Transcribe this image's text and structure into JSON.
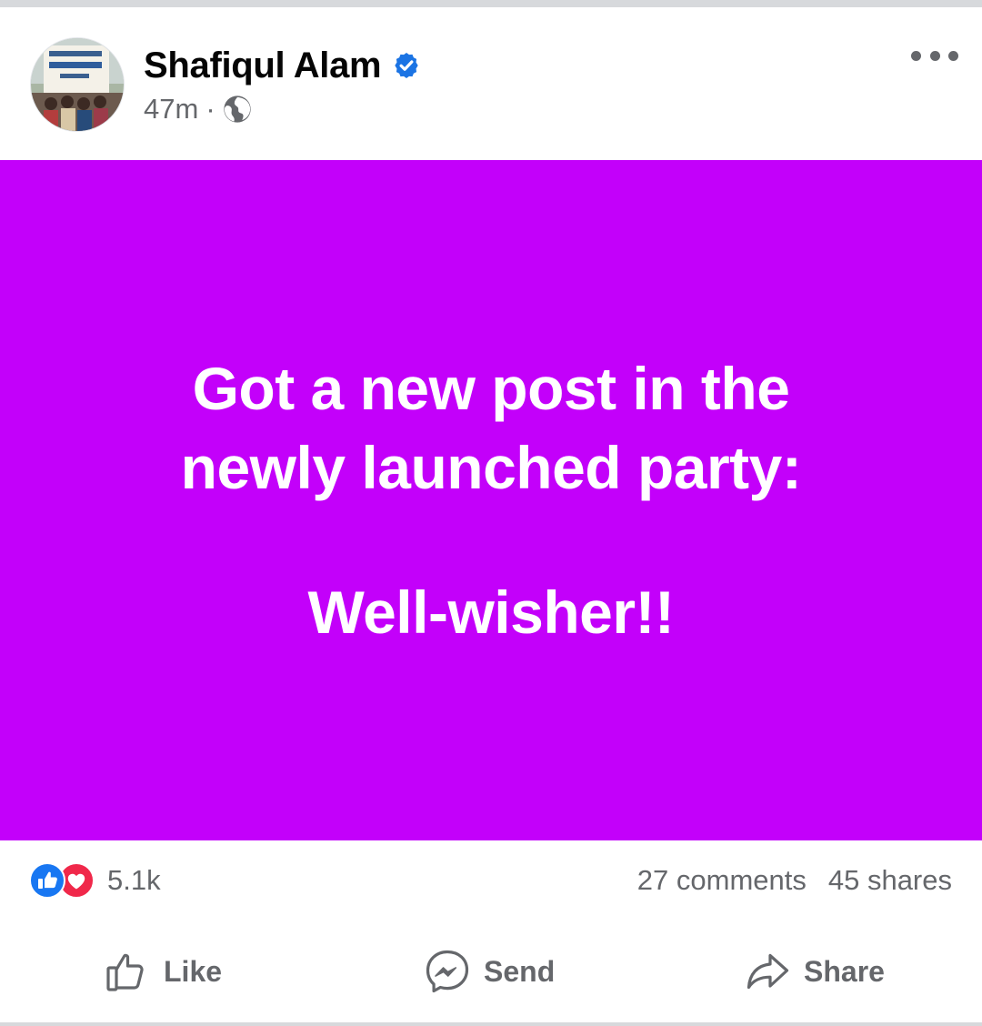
{
  "post": {
    "author": "Shafiqul Alam",
    "time": "47m",
    "separator": "·",
    "verified": true,
    "audience_icon": "globe-icon",
    "more_icon": "more-horizontal-icon",
    "background_color": "#c300fa",
    "text_color": "#ffffff",
    "text_lines": [
      "Got a new post in the",
      "newly launched party:"
    ],
    "closing_line": "Well-wisher!!"
  },
  "stats": {
    "reactions_count": "5.1k",
    "reaction_icons": [
      "like-reaction-icon",
      "love-reaction-icon"
    ],
    "comments": "27 comments",
    "shares": "45 shares"
  },
  "actions": {
    "like": "Like",
    "send": "Send",
    "share": "Share"
  },
  "colors": {
    "verified_blue": "#1b74e4",
    "like_blue": "#1877f2",
    "love_red": "#f0284a",
    "secondary_text": "#65676b"
  }
}
